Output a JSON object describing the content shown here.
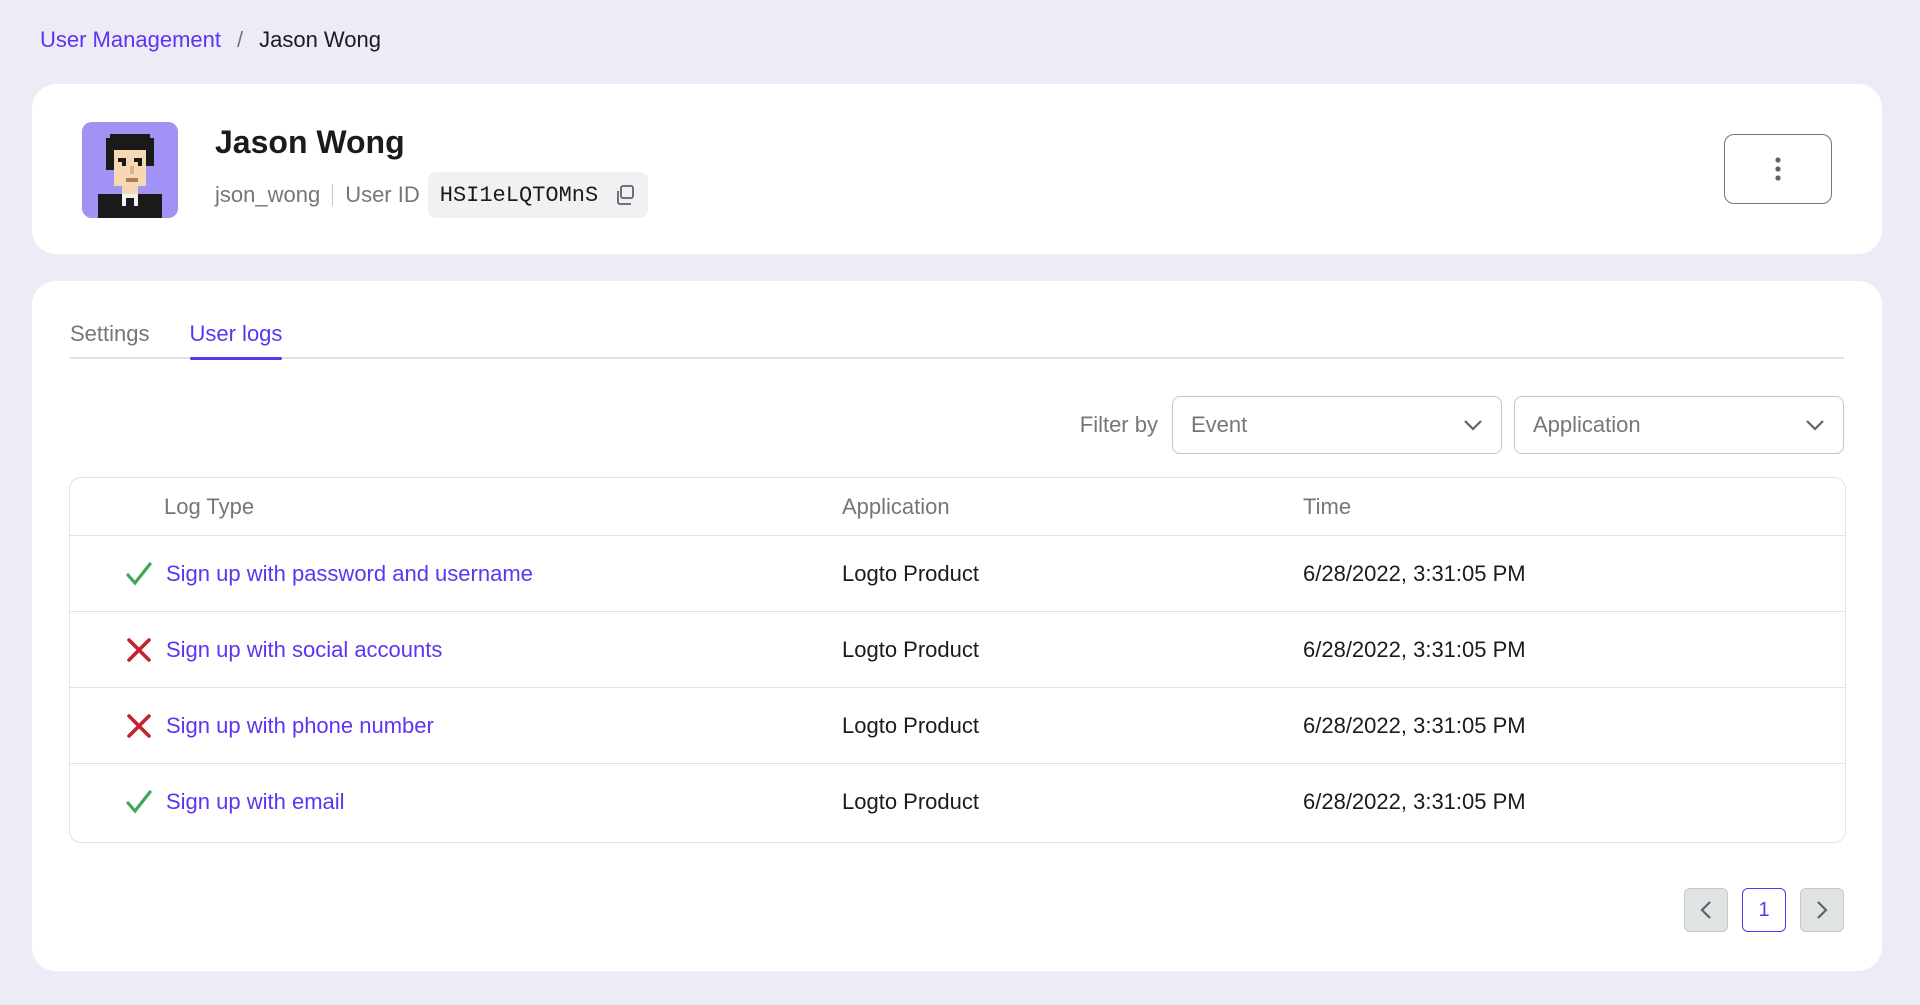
{
  "breadcrumb": {
    "parent": "User Management",
    "separator": "/",
    "current": "Jason Wong"
  },
  "user": {
    "name": "Jason Wong",
    "username": "json_wong",
    "user_id_label": "User ID",
    "user_id": "HSI1eLQTOMnS",
    "avatar_icon": "pixel-avatar"
  },
  "tabs": [
    {
      "label": "Settings",
      "active": false
    },
    {
      "label": "User logs",
      "active": true
    }
  ],
  "filters": {
    "label": "Filter by",
    "event_placeholder": "Event",
    "application_placeholder": "Application"
  },
  "table": {
    "headers": {
      "type": "Log Type",
      "application": "Application",
      "time": "Time"
    },
    "rows": [
      {
        "status": "success",
        "type": "Sign up with password and username",
        "application": "Logto Product",
        "time": "6/28/2022, 3:31:05 PM"
      },
      {
        "status": "failure",
        "type": "Sign up with social accounts",
        "application": "Logto Product",
        "time": "6/28/2022, 3:31:05 PM"
      },
      {
        "status": "failure",
        "type": "Sign up with phone number",
        "application": "Logto Product",
        "time": "6/28/2022, 3:31:05 PM"
      },
      {
        "status": "success",
        "type": "Sign up with email",
        "application": "Logto Product",
        "time": "6/28/2022, 3:31:05 PM"
      }
    ]
  },
  "pagination": {
    "current_page": "1"
  },
  "colors": {
    "accent": "#5d34f2",
    "success": "#3ea758",
    "error": "#c2222f",
    "background": "#ecebf6"
  }
}
